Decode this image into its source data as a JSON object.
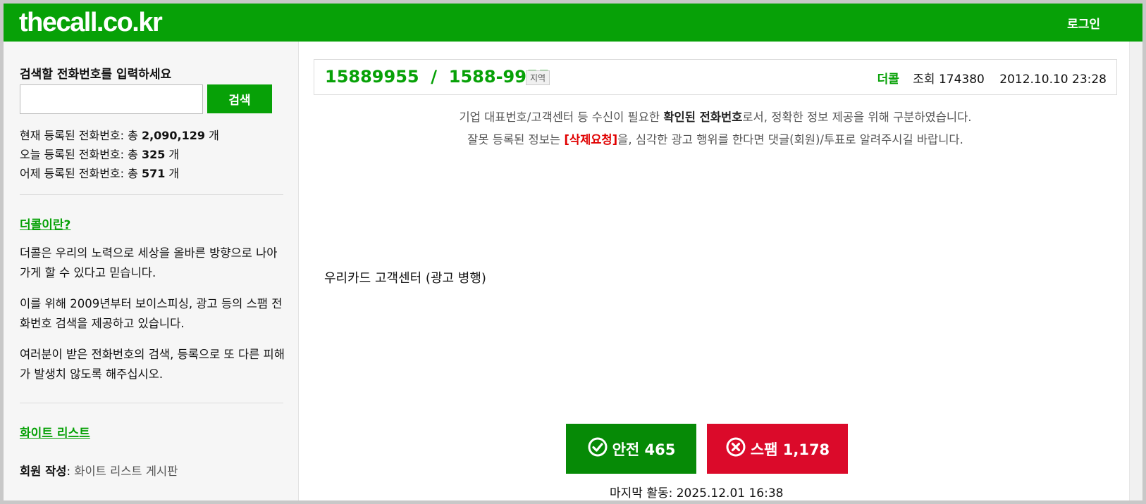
{
  "header": {
    "logo": "thecall.co.kr",
    "login": "로그인"
  },
  "sidebar": {
    "search_title": "검색할 전화번호를 입력하세요",
    "search_placeholder": "",
    "search_button": "검색",
    "stats": [
      {
        "prefix": "현재 등록된 전화번호: 총 ",
        "value": "2,090,129",
        "suffix": " 개"
      },
      {
        "prefix": "오늘 등록된 전화번호: 총 ",
        "value": "325",
        "suffix": " 개"
      },
      {
        "prefix": "어제 등록된 전화번호: 총 ",
        "value": "571",
        "suffix": " 개"
      }
    ],
    "about_link": "더콜이란?",
    "about_paras": [
      "더콜은 우리의 노력으로 세상을 올바른 방향으로 나아가게 할 수 있다고 믿습니다.",
      "이를 위해 2009년부터 보이스피싱, 광고 등의 스팸 전화번호 검색을 제공하고 있습니다.",
      "여러분이 받은 전화번호의 검색, 등록으로 또 다른 피해가 발생치 않도록 해주십시오."
    ],
    "whitelist_link": "화이트 리스트",
    "member_label": "회원 작성",
    "member_sep": ": ",
    "member_link": "화이트 리스트 게시판"
  },
  "main": {
    "number": "15889955  /  1588-9955",
    "region_tag": "지역",
    "brand": "더콜",
    "views": "조회 174380",
    "datetime": "2012.10.10 23:28",
    "notice1_pre": "기업 대표번호/고객센터 등 수신이 필요한 ",
    "notice1_bold": "확인된 전화번호",
    "notice1_post": "로서, 정확한 정보 제공을 위해 구분하였습니다.",
    "notice2_pre": "잘못 등록된 정보는 ",
    "notice2_red": "[삭제요청]",
    "notice2_post": "을, 심각한 광고 행위를 한다면 댓글(회원)/투표로 알려주시길 바랍니다.",
    "description": "우리카드 고객센터 (광고 병행)",
    "safe_label": "안전 465",
    "spam_label": "스팸 1,178",
    "last_activity": "마지막 활동: 2025.12.01 16:38"
  },
  "colors": {
    "brand_green": "#07a107",
    "safe": "#068a06",
    "spam": "#db0a2a",
    "alert_red": "#e00000"
  },
  "icons": {
    "safe": "check-circle-icon",
    "spam": "x-circle-icon"
  }
}
